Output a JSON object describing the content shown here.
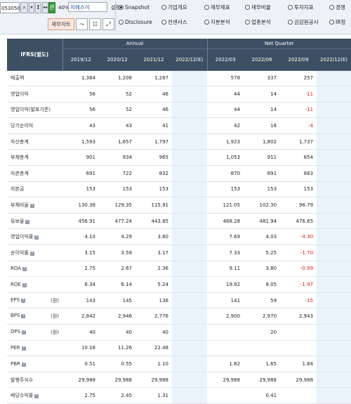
{
  "toolbar": {
    "stock_code": "053050",
    "search_icon": "search-icon",
    "dropdown_icon": "chevron-down-icon",
    "fav_label": "관",
    "stock_rate": "40%",
    "stock_name": "지에스이",
    "option_label": "설정",
    "chart_button": "재무차트",
    "radios_row1": [
      {
        "label": "Snapshot",
        "selected": true
      },
      {
        "label": "기업개요",
        "selected": false
      },
      {
        "label": "재무제표",
        "selected": false
      },
      {
        "label": "재무비율",
        "selected": false
      },
      {
        "label": "투자지표",
        "selected": false
      },
      {
        "label": "경쟁",
        "selected": false
      }
    ],
    "radios_row2": [
      {
        "label": "Disclosure",
        "selected": false
      },
      {
        "label": "컨센서스",
        "selected": false
      },
      {
        "label": "지분분석",
        "selected": false
      },
      {
        "label": "업종분석",
        "selected": false
      },
      {
        "label": "금감원공시",
        "selected": false
      },
      {
        "label": "IR정",
        "selected": false
      }
    ]
  },
  "table": {
    "header_ifrs": "IFRS(별도)",
    "group_annual": "Annual",
    "group_quarter": "Net Quarter",
    "columns": [
      "2019/12",
      "2020/12",
      "2021/12",
      "2022/12(E)",
      "2022/03",
      "2022/06",
      "2022/09",
      "2022/12(E)"
    ],
    "rows": [
      {
        "label": "매출액",
        "badge": false,
        "unit": "",
        "values": [
          "1,364",
          "1,208",
          "1,287",
          "",
          "578",
          "337",
          "257",
          ""
        ]
      },
      {
        "label": "영업이익",
        "badge": false,
        "unit": "",
        "values": [
          "56",
          "52",
          "46",
          "",
          "44",
          "14",
          "-11",
          ""
        ]
      },
      {
        "label": "영업이익(발표기준)",
        "badge": false,
        "unit": "",
        "values": [
          "56",
          "52",
          "46",
          "",
          "44",
          "14",
          "-11",
          ""
        ]
      },
      {
        "label": "당기순이익",
        "badge": false,
        "unit": "",
        "values": [
          "43",
          "43",
          "41",
          "",
          "42",
          "18",
          "-4",
          ""
        ]
      },
      {
        "label": "자산총계",
        "badge": false,
        "unit": "",
        "values": [
          "1,593",
          "1,657",
          "1,797",
          "",
          "1,923",
          "1,802",
          "1,737",
          ""
        ]
      },
      {
        "label": "부채총계",
        "badge": false,
        "unit": "",
        "values": [
          "901",
          "934",
          "965",
          "",
          "1,053",
          "911",
          "854",
          ""
        ]
      },
      {
        "label": "자본총계",
        "badge": false,
        "unit": "",
        "values": [
          "691",
          "722",
          "832",
          "",
          "870",
          "891",
          "883",
          ""
        ]
      },
      {
        "label": "자본금",
        "badge": false,
        "unit": "",
        "values": [
          "153",
          "153",
          "153",
          "",
          "153",
          "153",
          "153",
          ""
        ]
      },
      {
        "label": "부채비율",
        "badge": true,
        "unit": "",
        "values": [
          "130.38",
          "129.35",
          "115.91",
          "",
          "121.05",
          "102.30",
          "96.79",
          ""
        ]
      },
      {
        "label": "유보율",
        "badge": true,
        "unit": "",
        "values": [
          "456.91",
          "477.24",
          "443.85",
          "",
          "468.28",
          "481.94",
          "476.65",
          ""
        ]
      },
      {
        "label": "영업이익률",
        "badge": true,
        "unit": "",
        "values": [
          "4.10",
          "4.29",
          "3.60",
          "",
          "7.69",
          "4.03",
          "-4.30",
          ""
        ]
      },
      {
        "label": "순이익률",
        "badge": true,
        "unit": "",
        "values": [
          "3.15",
          "3.59",
          "3.17",
          "",
          "7.33",
          "5.25",
          "-1.70",
          ""
        ]
      },
      {
        "label": "ROA",
        "badge": true,
        "unit": "",
        "values": [
          "2.75",
          "2.67",
          "2.36",
          "",
          "9.11",
          "3.80",
          "-0.99",
          ""
        ]
      },
      {
        "label": "ROE",
        "badge": true,
        "unit": "",
        "values": [
          "6.34",
          "6.14",
          "5.24",
          "",
          "19.92",
          "8.05",
          "-1.97",
          ""
        ]
      },
      {
        "label": "EPS",
        "badge": true,
        "unit": "(원)",
        "values": [
          "143",
          "145",
          "136",
          "",
          "141",
          "59",
          "-15",
          ""
        ]
      },
      {
        "label": "BPS",
        "badge": true,
        "unit": "(원)",
        "values": [
          "2,842",
          "2,946",
          "2,776",
          "",
          "2,900",
          "2,970",
          "2,943",
          ""
        ]
      },
      {
        "label": "DPS",
        "badge": true,
        "unit": "(원)",
        "values": [
          "40",
          "40",
          "40",
          "",
          "",
          "20",
          "",
          ""
        ]
      },
      {
        "label": "PER",
        "badge": true,
        "unit": "",
        "values": [
          "10.16",
          "11.26",
          "22.48",
          "",
          "",
          "",
          "",
          ""
        ]
      },
      {
        "label": "PBR",
        "badge": true,
        "unit": "",
        "values": [
          "0.51",
          "0.55",
          "1.10",
          "",
          "1.82",
          "1.65",
          "1.84",
          ""
        ]
      },
      {
        "label": "발행주식수",
        "badge": false,
        "unit": "",
        "values": [
          "29,988",
          "29,988",
          "29,988",
          "",
          "29,988",
          "29,988",
          "29,988",
          ""
        ]
      },
      {
        "label": "배당수익률",
        "badge": true,
        "unit": "",
        "values": [
          "2.75",
          "2.45",
          "1.31",
          "",
          "",
          "0.41",
          "",
          ""
        ]
      }
    ]
  }
}
